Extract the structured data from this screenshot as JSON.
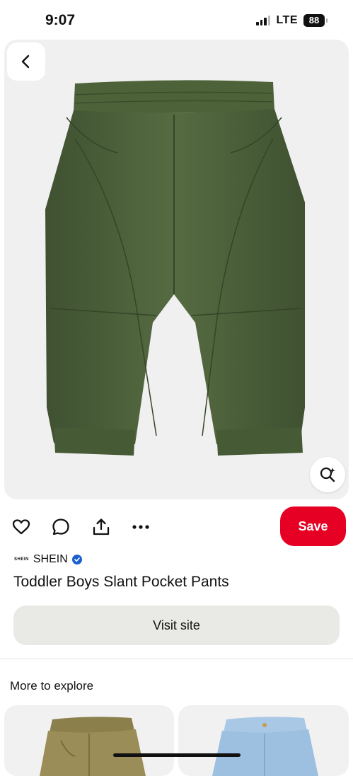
{
  "status_bar": {
    "time": "9:07",
    "network": "LTE",
    "battery": "88"
  },
  "product": {
    "brand_logo_text": "SHEIN",
    "brand_name": "SHEIN",
    "title": "Toddler Boys Slant Pocket Pants",
    "image_colors": {
      "background": "#f0f0f0",
      "pants": "#4b5e39"
    }
  },
  "actions": {
    "icons": [
      "heart-icon",
      "comment-icon",
      "share-icon",
      "more-icon"
    ],
    "save_label": "Save",
    "visit_label": "Visit site"
  },
  "explore": {
    "heading": "More to explore",
    "cards": [
      {
        "icon": "pants-thumbnail",
        "color": "#8b7f4c"
      },
      {
        "icon": "jeans-thumbnail",
        "color": "#9dbfe0"
      }
    ]
  },
  "colors": {
    "accent": "#e60023",
    "verified": "#1c5fd1"
  }
}
